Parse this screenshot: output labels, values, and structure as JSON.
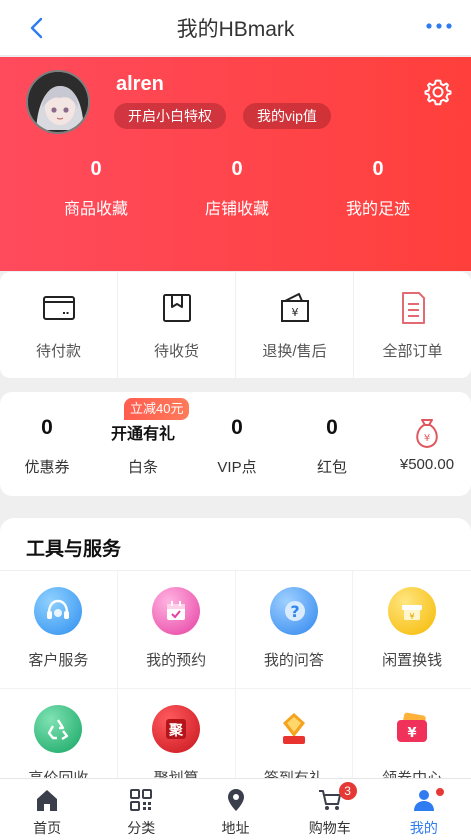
{
  "header": {
    "title": "我的HBmark"
  },
  "profile": {
    "username": "alren",
    "tags": [
      "开启小白特权",
      "我的vip值"
    ],
    "stats": [
      {
        "value": "0",
        "label": "商品收藏"
      },
      {
        "value": "0",
        "label": "店铺收藏"
      },
      {
        "value": "0",
        "label": "我的足迹"
      }
    ]
  },
  "orders": [
    {
      "label": "待付款",
      "icon": "wallet-icon"
    },
    {
      "label": "待收货",
      "icon": "package-icon"
    },
    {
      "label": "退换/售后",
      "icon": "refund-icon"
    },
    {
      "label": "全部订单",
      "icon": "order-list-icon"
    }
  ],
  "assets": {
    "promo": "立减40元",
    "items": [
      {
        "value": "0",
        "label": "优惠券"
      },
      {
        "value": "开通有礼",
        "label": "白条"
      },
      {
        "value": "0",
        "label": "VIP点"
      },
      {
        "value": "0",
        "label": "红包"
      },
      {
        "value": "",
        "label": "¥500.00",
        "icon": "money-bag-icon"
      }
    ]
  },
  "tools": {
    "title": "工具与服务",
    "items": [
      {
        "label": "客户服务",
        "icon": "customer-service-icon",
        "color": "#3ea6f3"
      },
      {
        "label": "我的预约",
        "icon": "calendar-icon",
        "color": "#f05bb3"
      },
      {
        "label": "我的问答",
        "icon": "question-icon",
        "color": "#3b96f5"
      },
      {
        "label": "闲置换钱",
        "icon": "gold-box-icon",
        "color": "#f7c21c"
      },
      {
        "label": "高价回收",
        "icon": "recycle-icon",
        "color": "#22b573"
      },
      {
        "label": "聚划算",
        "icon": "ju-icon",
        "color": "#e8252b"
      },
      {
        "label": "签到有礼",
        "icon": "checkin-icon",
        "color": "#f29b1c"
      },
      {
        "label": "领券中心",
        "icon": "coupon-icon",
        "color": "#f0325a"
      }
    ]
  },
  "tabbar": {
    "items": [
      {
        "label": "首页",
        "icon": "home-icon"
      },
      {
        "label": "分类",
        "icon": "category-icon"
      },
      {
        "label": "地址",
        "icon": "location-icon"
      },
      {
        "label": "购物车",
        "icon": "cart-icon",
        "badge": "3"
      },
      {
        "label": "我的",
        "icon": "user-icon",
        "active": true
      }
    ]
  },
  "colors": {
    "brand_red": "#ff4b4b",
    "active_blue": "#2f7bf0"
  }
}
